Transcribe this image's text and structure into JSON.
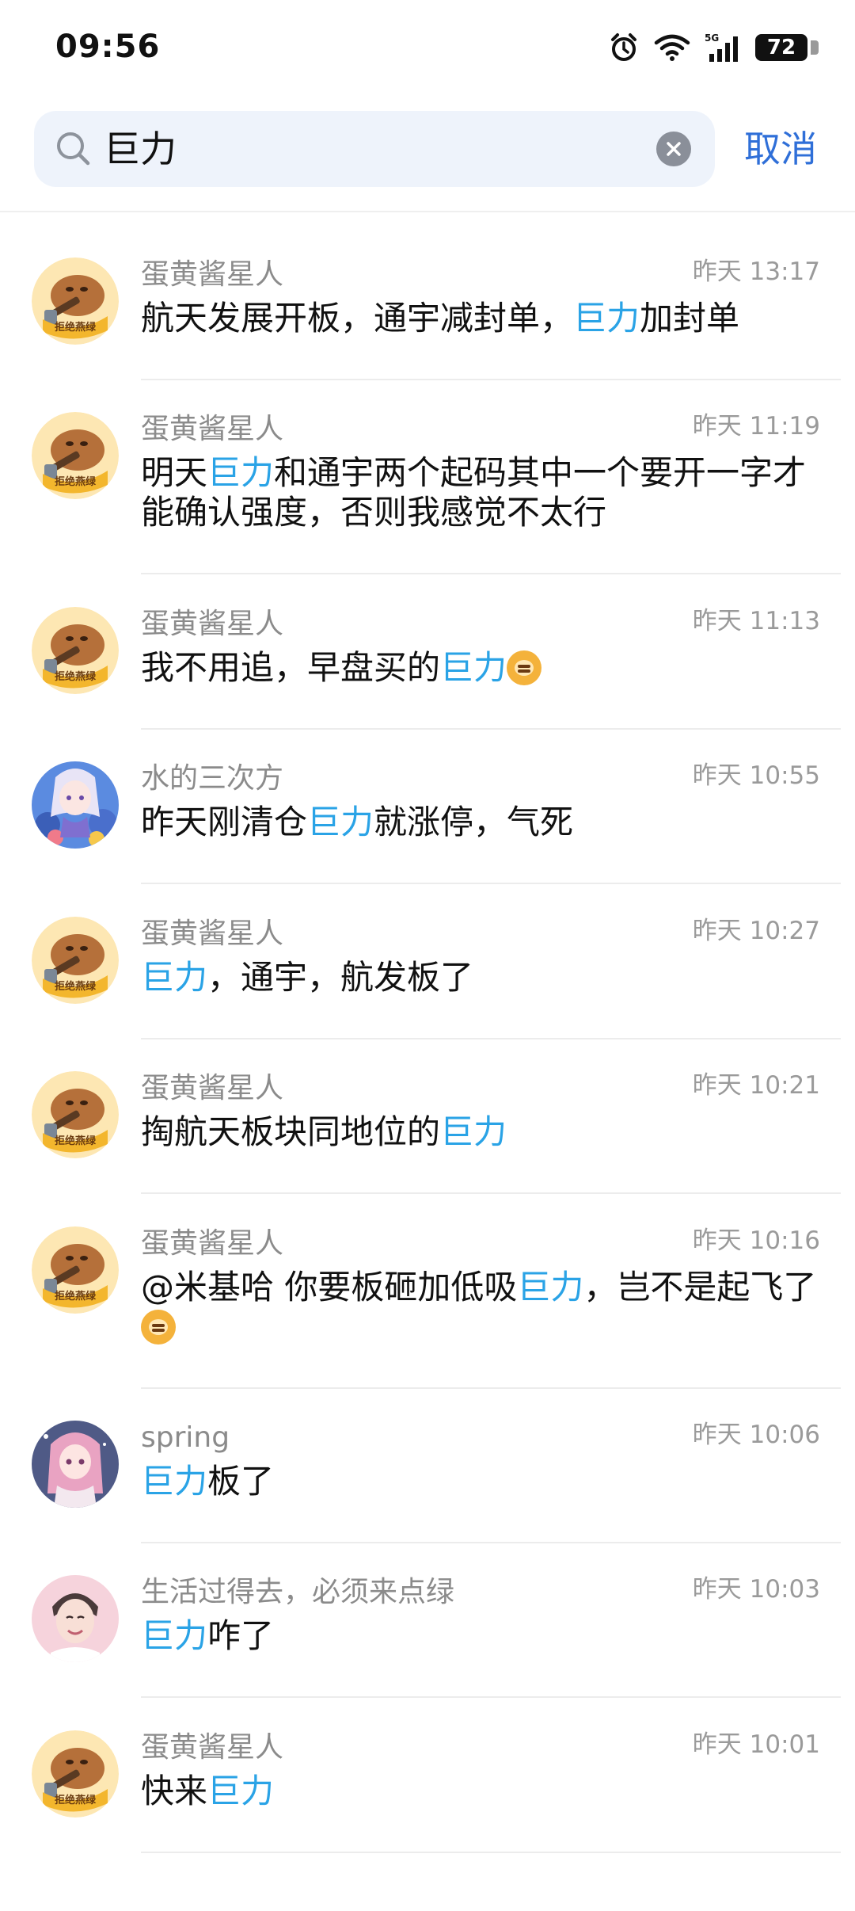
{
  "status_bar": {
    "time": "09:56",
    "battery": "72"
  },
  "search": {
    "query": "巨力",
    "cancel_label": "取消"
  },
  "results": [
    {
      "name": "蛋黄酱星人",
      "time": "昨天 13:17",
      "avatar": "capybara-sticker",
      "parts": [
        {
          "t": "航天发展开板，通宇减封单，",
          "hl": false
        },
        {
          "t": "巨力",
          "hl": true
        },
        {
          "t": "加封单",
          "hl": false
        }
      ]
    },
    {
      "name": "蛋黄酱星人",
      "time": "昨天 11:19",
      "avatar": "capybara-sticker",
      "parts": [
        {
          "t": "明天",
          "hl": false
        },
        {
          "t": "巨力",
          "hl": true
        },
        {
          "t": "和通宇两个起码其中一个要开一字才能确认强度，否则我感觉不太行",
          "hl": false
        }
      ]
    },
    {
      "name": "蛋黄酱星人",
      "time": "昨天 11:13",
      "avatar": "capybara-sticker",
      "parts": [
        {
          "t": "我不用追，早盘买的",
          "hl": false
        },
        {
          "t": "巨力",
          "hl": true
        },
        {
          "emoji": "doge-emoji"
        }
      ]
    },
    {
      "name": "水的三次方",
      "time": "昨天 10:55",
      "avatar": "anime-girl-flowers",
      "parts": [
        {
          "t": "昨天刚清仓",
          "hl": false
        },
        {
          "t": "巨力",
          "hl": true
        },
        {
          "t": "就涨停，气死",
          "hl": false
        }
      ]
    },
    {
      "name": "蛋黄酱星人",
      "time": "昨天 10:27",
      "avatar": "capybara-sticker",
      "parts": [
        {
          "t": "巨力",
          "hl": true
        },
        {
          "t": "，通宇，航发板了",
          "hl": false
        }
      ]
    },
    {
      "name": "蛋黄酱星人",
      "time": "昨天 10:21",
      "avatar": "capybara-sticker",
      "parts": [
        {
          "t": "掏航天板块同地位的",
          "hl": false
        },
        {
          "t": "巨力",
          "hl": true
        }
      ]
    },
    {
      "name": "蛋黄酱星人",
      "time": "昨天 10:16",
      "avatar": "capybara-sticker",
      "parts": [
        {
          "t": "@米基哈 你要板砸加低吸",
          "hl": false
        },
        {
          "t": "巨力",
          "hl": true
        },
        {
          "t": "，岂不是起飞了",
          "hl": false
        },
        {
          "emoji": "doge-emoji"
        }
      ]
    },
    {
      "name": "spring",
      "time": "昨天 10:06",
      "avatar": "anime-girl-pink",
      "parts": [
        {
          "t": "巨力",
          "hl": true
        },
        {
          "t": "板了",
          "hl": false
        }
      ]
    },
    {
      "name": "生活过得去，必须来点绿",
      "time": "昨天 10:03",
      "avatar": "boy-portrait",
      "parts": [
        {
          "t": "巨力",
          "hl": true
        },
        {
          "t": "咋了",
          "hl": false
        }
      ]
    },
    {
      "name": "蛋黄酱星人",
      "time": "昨天 10:01",
      "avatar": "capybara-sticker",
      "parts": [
        {
          "t": "快来",
          "hl": false
        },
        {
          "t": "巨力",
          "hl": true
        }
      ]
    }
  ],
  "colors": {
    "highlight": "#2aa3e6",
    "accent": "#2f6fd8",
    "search_bg": "#eef3fb"
  }
}
